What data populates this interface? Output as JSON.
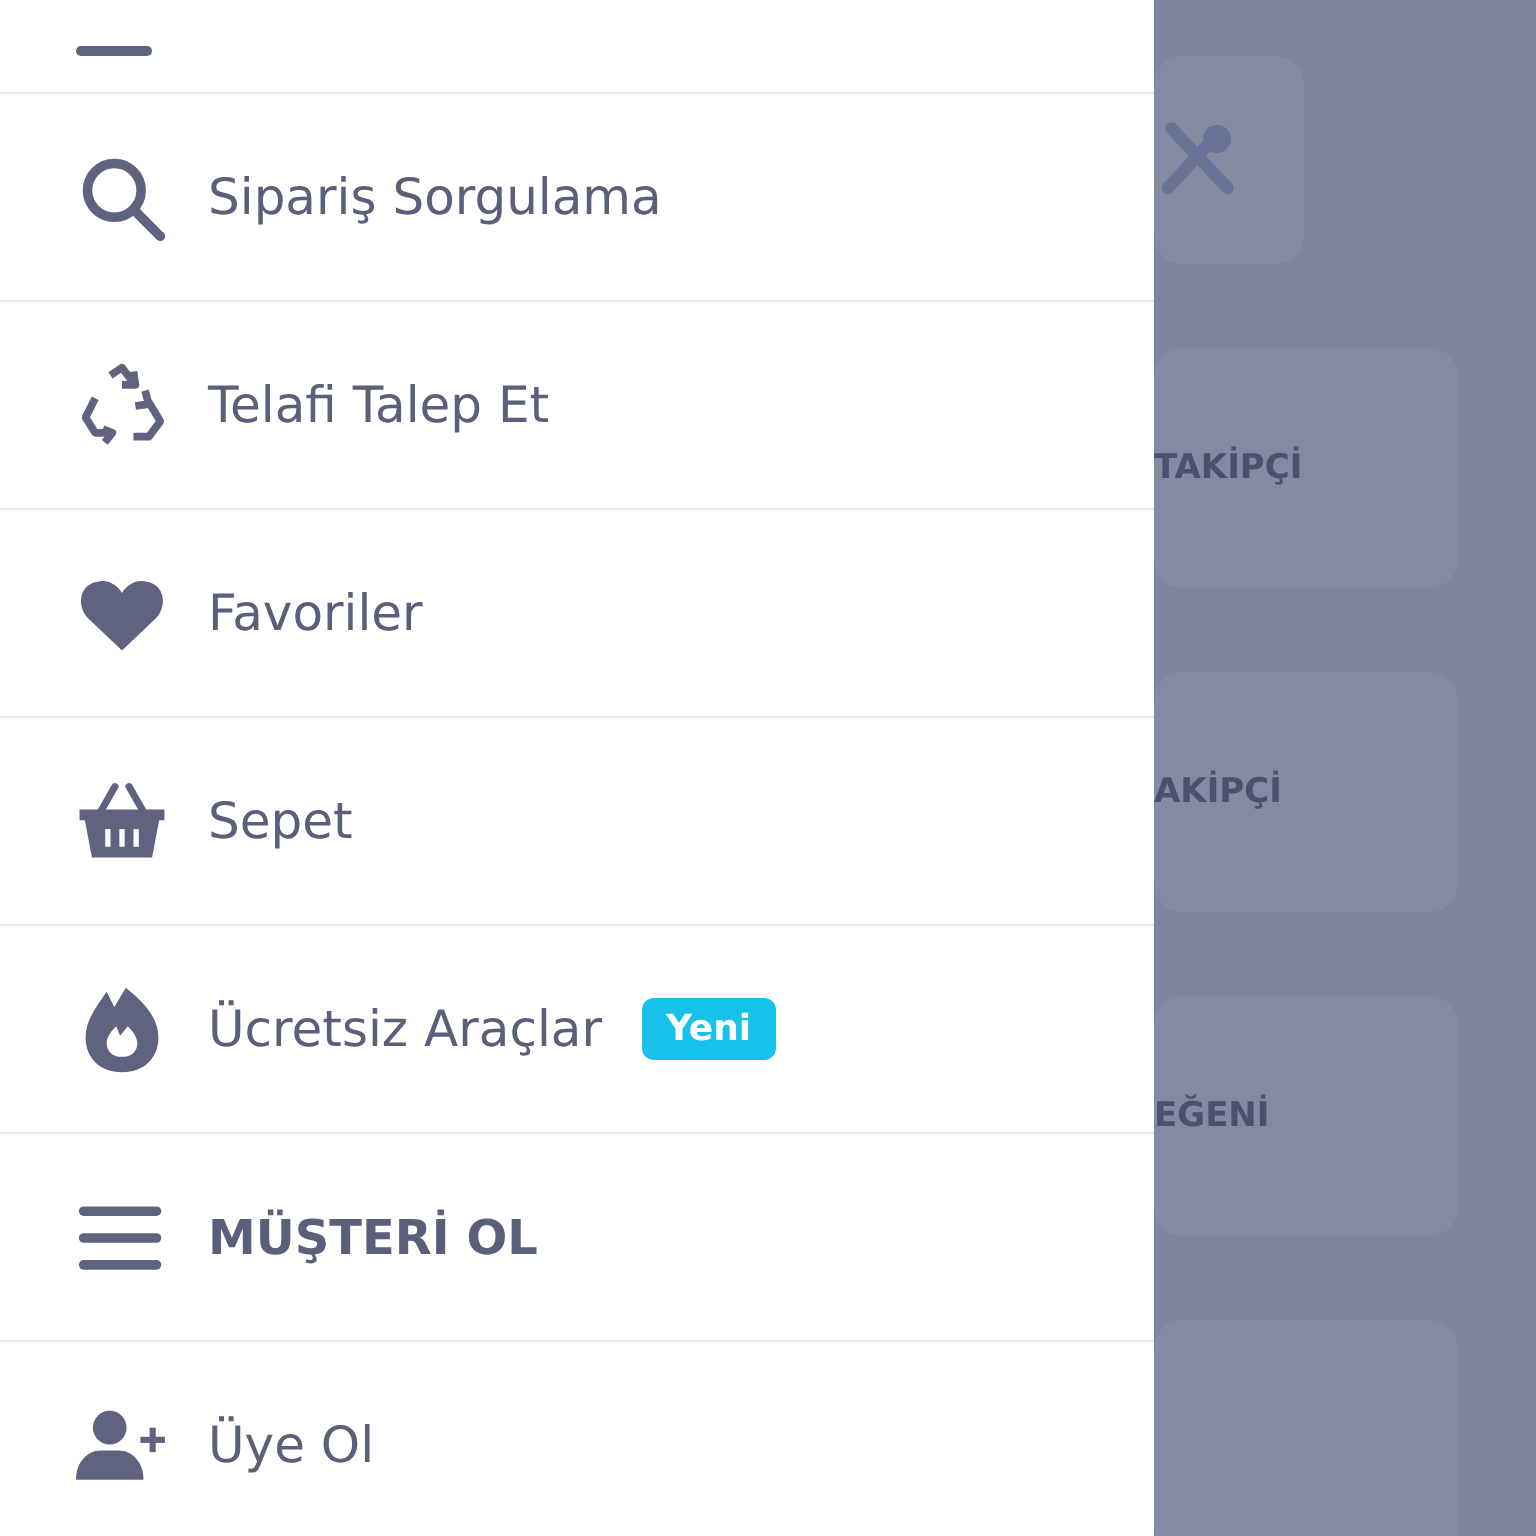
{
  "menu": [
    {
      "kind": "section-cut"
    },
    {
      "kind": "link",
      "label": "Sipariş Sorgulama"
    },
    {
      "kind": "link",
      "label": "Telafi Talep Et"
    },
    {
      "kind": "link",
      "label": "Favoriler"
    },
    {
      "kind": "link",
      "label": "Sepet"
    },
    {
      "kind": "link",
      "label": "Ücretsiz Araçlar",
      "badge": "Yeni"
    },
    {
      "kind": "section",
      "label": "MÜŞTERİ OL"
    },
    {
      "kind": "link",
      "label": "Üye Ol"
    }
  ],
  "background_cards": [
    {
      "kind": "tools"
    },
    {
      "kind": "stat",
      "label": "TAKİPÇİ"
    },
    {
      "kind": "stat",
      "label": "AKİPÇİ"
    },
    {
      "kind": "stat",
      "label": "EĞENİ"
    },
    {
      "kind": "stat"
    }
  ]
}
